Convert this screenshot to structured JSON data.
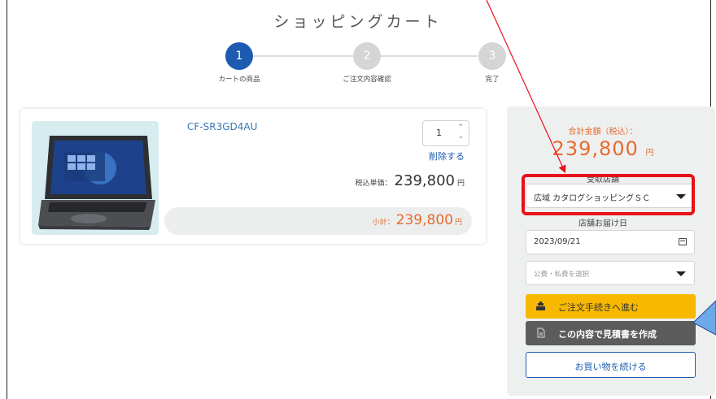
{
  "header": {
    "title": "ショッピングカート"
  },
  "steps": [
    {
      "number": "1",
      "label": "カートの商品",
      "active": true
    },
    {
      "number": "2",
      "label": "ご注文内容確認",
      "active": false
    },
    {
      "number": "3",
      "label": "完了",
      "active": false
    }
  ],
  "cart_item": {
    "product_name": "CF-SR3GD4AU",
    "quantity": "1",
    "delete_label": "削除する",
    "unit_price_label": "税込単価：",
    "unit_price": "239,800",
    "currency": "円",
    "subtotal_label": "小計：",
    "subtotal": "239,800"
  },
  "summary": {
    "total_label": "合計金額（税込）：",
    "total_amount": "239,800",
    "currency": "円",
    "store_label": "受取店舗",
    "store_value": "広域 カタログショッピングＳＣ",
    "delivery_label": "店舗お届け日",
    "delivery_date": "2023/09/21",
    "usage_placeholder": "公費・私費を選択",
    "order_button": "ご注文手続きへ進む",
    "quote_button": "この内容で見積書を作成",
    "continue_button": "お買い物を続ける"
  },
  "colors": {
    "accent_blue": "#1d5bb0",
    "price_orange": "#e8692d",
    "order_yellow": "#f8b800",
    "quote_gray": "#5c5c5c",
    "highlight_red": "#e8101a"
  }
}
